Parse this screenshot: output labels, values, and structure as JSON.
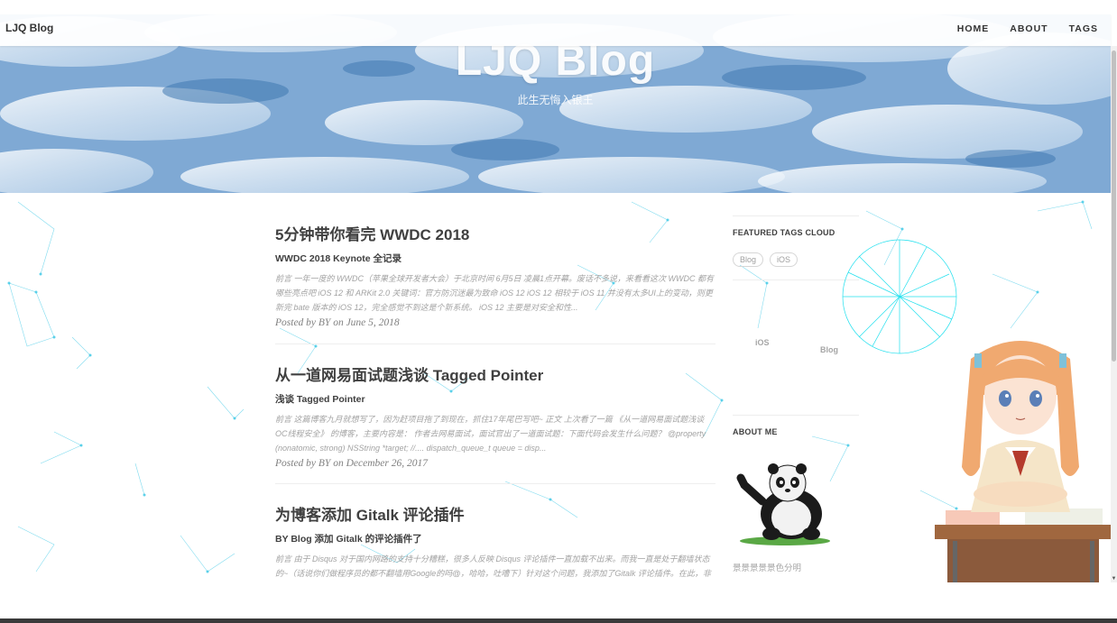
{
  "nav": {
    "brand": "LJQ Blog",
    "links": [
      "HOME",
      "ABOUT",
      "TAGS"
    ]
  },
  "header": {
    "title": "LJQ Blog",
    "subtitle": "此生无悔入银王"
  },
  "posts": [
    {
      "title": "5分钟带你看完 WWDC 2018",
      "subtitle": "WWDC 2018 Keynote 全记录",
      "excerpt": "前言 一年一度的 WWDC（苹果全球开发者大会）于北京时间 6月5日 凌晨1点开幕。废话不多说，来看看这次 WWDC 都有哪些亮点吧 iOS 12 和 ARKit 2.0 关键词：官方防沉迷最为致命 iOS 12 iOS 12 相较于 iOS 11 并没有太多UI上的变动，则更新完 bate 版本的 iOS 12，完全感觉不到这是个新系统。 iOS 12 主要是对安全和性...",
      "meta": "Posted by BY on June 5, 2018"
    },
    {
      "title": "从一道网易面试题浅谈 Tagged Pointer",
      "subtitle": "浅谈 Tagged Pointer",
      "excerpt": "前言 这篇博客九月就想写了，因为赶项目拖了到现在，抓住17年尾巴写吧~ 正文 上次看了一篇 《从一道网易面试题浅谈OC线程安全》 的博客，主要内容是： 作者去网易面试，面试官出了一道面试题：下面代码会发生什么问题？ @property (nonatomic, strong) NSString *target; //.... dispatch_queue_t queue = disp...",
      "meta": "Posted by BY on December 26, 2017"
    },
    {
      "title": "为博客添加 Gitalk 评论插件",
      "subtitle": "BY Blog 添加 Gitalk 的评论插件了",
      "excerpt": "前言 由于 Disqus 对于国内网路的支持十分糟糕，很多人反映 Disqus 评论插件一直加载不出来。而我一直是处于翻墙状态的~（话说你们做程序员的都不翻墙用Google的吗@，哈哈，吐嘈下）针对这个问题，我添加了Gitalk 评论插件。在此，非常感谢 @FeDemo 的推荐。 正文 Gitalk 评论插件 首先来看看 Gitalk 的界面和功能：gitalk 使...",
      "meta": ""
    }
  ],
  "sidebar": {
    "tags_title": "FEATURED TAGS CLOUD",
    "tags": [
      "Blog",
      "iOS"
    ],
    "cloud_words": [
      "iOS",
      "Blog"
    ],
    "about_title": "ABOUT ME",
    "about_text": "景景景景景色分明"
  },
  "icons": {
    "panda": "panda-waving-icon",
    "mascot": "anime-girl-mascot",
    "globe": "tag-globe-icon"
  },
  "colors": {
    "link_net": "#3cc8e6",
    "hero_blue": "#5f93c7"
  }
}
